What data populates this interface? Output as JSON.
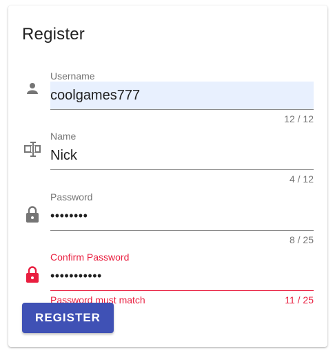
{
  "form": {
    "title": "Register",
    "fields": [
      {
        "icon": "person-icon",
        "label": "Username",
        "value": "coolgames777",
        "counter": "12 / 12",
        "hint": "",
        "error": false
      },
      {
        "icon": "text-cursor-icon",
        "label": "Name",
        "value": "Nick",
        "counter": "4 / 12",
        "hint": "",
        "error": false
      },
      {
        "icon": "lock-icon",
        "label": "Password",
        "value": "••••••••",
        "counter": "8 / 25",
        "hint": "",
        "error": false
      },
      {
        "icon": "lock-icon",
        "label": "Confirm Password",
        "value": "•••••••••••",
        "counter": "11 / 25",
        "hint": "Password must match",
        "error": true
      }
    ],
    "submit_label": "REGISTER"
  },
  "colors": {
    "primary": "#3f51b5",
    "error": "#e91e3f",
    "autofill_bg": "#e8f0fe",
    "icon": "#757575"
  }
}
